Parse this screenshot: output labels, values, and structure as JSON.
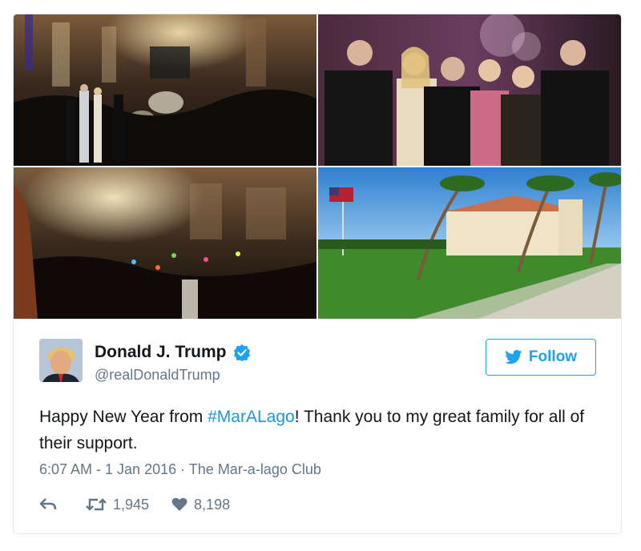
{
  "tweet": {
    "author_name": "Donald J. Trump",
    "author_handle": "@realDonaldTrump",
    "follow_label": "Follow",
    "text_before": "Happy New Year from ",
    "hashtag": "#MarALago",
    "text_after": "! Thank you to my great family for all of their support.",
    "timestamp": "6:07 AM - 1 Jan 2016",
    "separator": " · ",
    "location": "The Mar-a-lago Club",
    "retweets": "1,945",
    "likes": "8,198"
  },
  "photos": [
    "party-ballroom-photo",
    "family-group-photo",
    "crowd-concert-photo",
    "estate-exterior-photo"
  ],
  "colors": {
    "accent": "#1da1f2",
    "hashtag": "#1b95e0",
    "muted": "#657786",
    "text": "#14171a",
    "border": "#e1e8ed"
  },
  "icons": [
    "verified-badge-icon",
    "twitter-bird-icon",
    "reply-icon",
    "retweet-icon",
    "heart-icon"
  ]
}
